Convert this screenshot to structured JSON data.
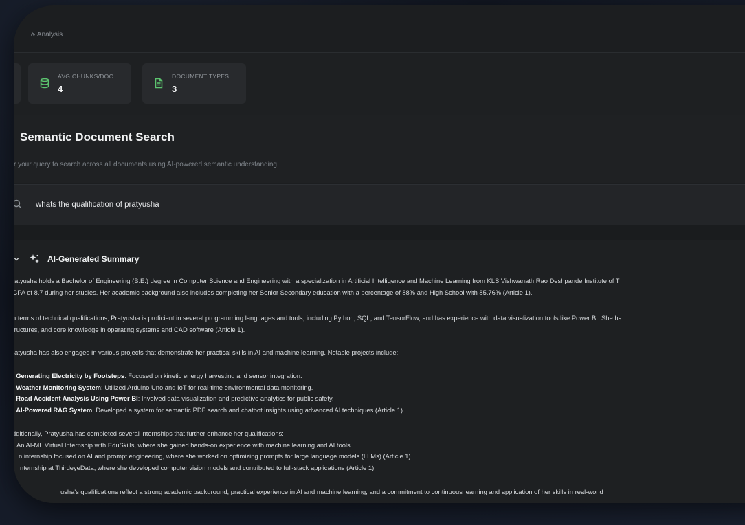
{
  "header": {
    "breadcrumb": "& Analysis"
  },
  "stats": [
    {
      "label": "AVG CHUNKS/DOC",
      "value": "4",
      "icon": "database-icon"
    },
    {
      "label": "DOCUMENT TYPES",
      "value": "3",
      "icon": "file-text-icon"
    }
  ],
  "search": {
    "title": "Semantic Document Search",
    "subtitle": "r your query to search across all documents using AI-powered semantic understanding",
    "query": "whats the qualification of pratyusha"
  },
  "summary": {
    "title": "AI-Generated Summary",
    "lines": [
      "ratyusha holds a Bachelor of Engineering (B.E.) degree in Computer Science and Engineering with a specialization in Artificial Intelligence and Machine Learning from KLS Vishwanath Rao Deshpande Institute of T",
      "GPA of 8.7 during her studies. Her academic background also includes completing her Senior Secondary education with a percentage of 88% and High School with 85.76% (Article 1).",
      "n terms of technical qualifications, Pratyusha is proficient in several programming languages and tools, including Python, SQL, and TensorFlow, and has experience with data visualization tools like Power BI. She ha",
      "tructures, and core knowledge in operating systems and CAD software (Article 1).",
      "ratyusha has also engaged in various projects that demonstrate her practical skills in AI and machine learning. Notable projects include:"
    ],
    "projects": [
      {
        "num": ".",
        "name": "Generating Electricity by Footsteps",
        "desc": ": Focused on kinetic energy harvesting and sensor integration."
      },
      {
        "num": ".",
        "name": "Weather Monitoring System",
        "desc": ": Utilized Arduino Uno and IoT for real-time environmental data monitoring."
      },
      {
        "num": ".",
        "name": "Road Accident Analysis Using Power BI",
        "desc": ": Involved data visualization and predictive analytics for public safety."
      },
      {
        "num": ".",
        "name": "AI-Powered RAG System",
        "desc": ": Developed a system for semantic PDF search and chatbot insights using advanced AI techniques (Article 1)."
      }
    ],
    "internships_intro": "dditionally, Pratyusha has completed several internships that further enhance her qualifications:",
    "internships": [
      "An AI-ML Virtual Internship with EduSkills, where she gained hands-on experience with machine learning and AI tools.",
      "n internship focused on AI and prompt engineering, where she worked on optimizing prompts for large language models (LLMs) (Article 1).",
      "nternship at ThirdeyeData, where she developed computer vision models and contributed to full-stack applications (Article 1)."
    ],
    "conclusion": "usha's qualifications reflect a strong academic background, practical experience in AI and machine learning, and a commitment to continuous learning and application of her skills in real-world"
  },
  "colors": {
    "accent_green": "#5cc46f",
    "panel": "#1e2022",
    "card": "#282a2d"
  }
}
